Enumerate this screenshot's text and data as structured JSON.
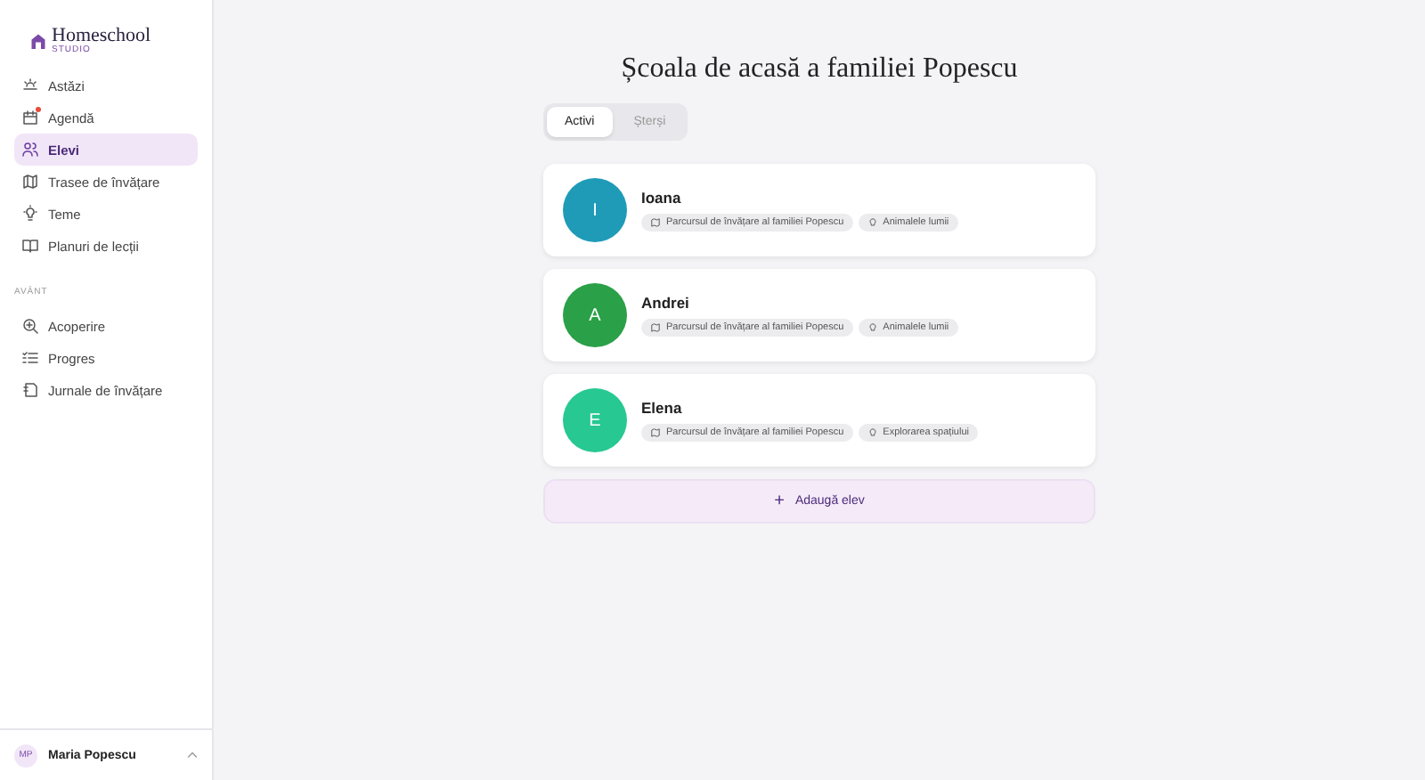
{
  "sidebar": {
    "logo": {
      "name": "Homeschool",
      "sub": "STUDIO"
    },
    "items": [
      {
        "label": "Astăzi",
        "selected": false,
        "notification": false
      },
      {
        "label": "Agendă",
        "selected": false,
        "notification": true
      },
      {
        "label": "Elevi",
        "selected": true,
        "notification": false
      },
      {
        "label": "Trasee de învățare",
        "selected": false,
        "notification": false
      },
      {
        "label": "Teme",
        "selected": false,
        "notification": false
      },
      {
        "label": "Planuri de lecții",
        "selected": false,
        "notification": false
      }
    ],
    "section": "AVÂNT",
    "section_items": [
      {
        "label": "Acoperire",
        "selected": false
      },
      {
        "label": "Progres",
        "selected": false
      },
      {
        "label": "Jurnale de învățare",
        "selected": false
      }
    ],
    "user": {
      "initials": "MP",
      "name": "Maria Popescu"
    }
  },
  "title": "Școala de acasă a familiei Popescu",
  "tabs": [
    {
      "label": "Activi",
      "selected": true
    },
    {
      "label": "Șterși",
      "selected": false
    }
  ],
  "students": [
    {
      "initial": "I",
      "name": "Ioana",
      "color": "#1f9bb8",
      "path": "Parcursul de învățare al familiei Popescu",
      "theme": "Animalele lumii"
    },
    {
      "initial": "A",
      "name": "Andrei",
      "color": "#2aa048",
      "path": "Parcursul de învățare al familiei Popescu",
      "theme": "Animalele lumii"
    },
    {
      "initial": "E",
      "name": "Elena",
      "color": "#27c892",
      "path": "Parcursul de învățare al familiei Popescu",
      "theme": "Explorarea spațiului"
    }
  ],
  "add_button": {
    "icon": "+",
    "label": "Adaugă elev"
  }
}
